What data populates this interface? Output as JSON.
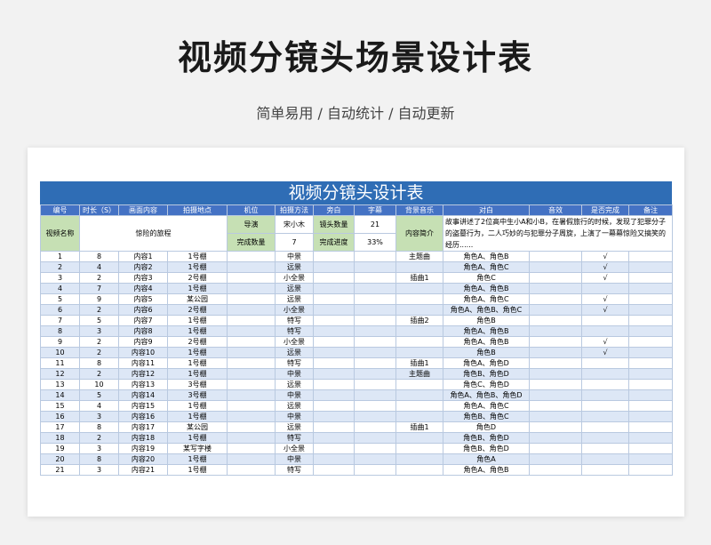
{
  "header": {
    "title": "视频分镜头场景设计表",
    "subtitle": "简单易用 / 自动统计 / 自动更新"
  },
  "sheet": {
    "banner_title": "视频分镜头设计表",
    "info": {
      "video_name_label": "视频名称",
      "video_name_value": "惊险的旅程",
      "director_label": "导演",
      "director_value": "宋小木",
      "shot_count_label": "镜头数量",
      "shot_count_value": "21",
      "completed_count_label": "完成数量",
      "completed_count_value": "7",
      "progress_label": "完成进度",
      "progress_value": "33%",
      "intro_label": "内容简介",
      "intro_text": "故事讲述了2位高中生小A和小B，在暑假旅行的时候，发现了犯罪分子的盗墓行为，二人巧妙的与犯罪分子周旋，上演了一幕幕惊险又搞笑的经历......"
    },
    "columns": [
      "编号",
      "时长（S）",
      "画面内容",
      "拍摄地点",
      "机位",
      "拍摄方法",
      "旁白",
      "字幕",
      "背景音乐",
      "对白",
      "音效",
      "是否完成",
      "备注"
    ],
    "rows": [
      [
        "1",
        "8",
        "内容1",
        "1号棚",
        "",
        "中景",
        "",
        "",
        "主题曲",
        "角色A、角色B",
        "",
        "√",
        ""
      ],
      [
        "2",
        "4",
        "内容2",
        "1号棚",
        "",
        "远景",
        "",
        "",
        "",
        "角色A、角色C",
        "",
        "√",
        ""
      ],
      [
        "3",
        "2",
        "内容3",
        "2号棚",
        "",
        "小全景",
        "",
        "",
        "插曲1",
        "角色C",
        "",
        "√",
        ""
      ],
      [
        "4",
        "7",
        "内容4",
        "1号棚",
        "",
        "远景",
        "",
        "",
        "",
        "角色A、角色B",
        "",
        "",
        ""
      ],
      [
        "5",
        "9",
        "内容5",
        "某公园",
        "",
        "远景",
        "",
        "",
        "",
        "角色A、角色C",
        "",
        "√",
        ""
      ],
      [
        "6",
        "2",
        "内容6",
        "2号棚",
        "",
        "小全景",
        "",
        "",
        "",
        "角色A、角色B、角色C",
        "",
        "√",
        ""
      ],
      [
        "7",
        "5",
        "内容7",
        "1号棚",
        "",
        "特写",
        "",
        "",
        "插曲2",
        "角色B",
        "",
        "",
        ""
      ],
      [
        "8",
        "3",
        "内容8",
        "1号棚",
        "",
        "特写",
        "",
        "",
        "",
        "角色A、角色B",
        "",
        "",
        ""
      ],
      [
        "9",
        "2",
        "内容9",
        "2号棚",
        "",
        "小全景",
        "",
        "",
        "",
        "角色A、角色B",
        "",
        "√",
        ""
      ],
      [
        "10",
        "2",
        "内容10",
        "1号棚",
        "",
        "远景",
        "",
        "",
        "",
        "角色B",
        "",
        "√",
        ""
      ],
      [
        "11",
        "8",
        "内容11",
        "1号棚",
        "",
        "特写",
        "",
        "",
        "插曲1",
        "角色A、角色D",
        "",
        "",
        ""
      ],
      [
        "12",
        "2",
        "内容12",
        "1号棚",
        "",
        "中景",
        "",
        "",
        "主题曲",
        "角色B、角色D",
        "",
        "",
        ""
      ],
      [
        "13",
        "10",
        "内容13",
        "3号棚",
        "",
        "远景",
        "",
        "",
        "",
        "角色C、角色D",
        "",
        "",
        ""
      ],
      [
        "14",
        "5",
        "内容14",
        "3号棚",
        "",
        "中景",
        "",
        "",
        "",
        "角色A、角色B、角色D",
        "",
        "",
        ""
      ],
      [
        "15",
        "4",
        "内容15",
        "1号棚",
        "",
        "远景",
        "",
        "",
        "",
        "角色A、角色C",
        "",
        "",
        ""
      ],
      [
        "16",
        "3",
        "内容16",
        "1号棚",
        "",
        "中景",
        "",
        "",
        "",
        "角色B、角色C",
        "",
        "",
        ""
      ],
      [
        "17",
        "8",
        "内容17",
        "某公园",
        "",
        "远景",
        "",
        "",
        "插曲1",
        "角色D",
        "",
        "",
        ""
      ],
      [
        "18",
        "2",
        "内容18",
        "1号棚",
        "",
        "特写",
        "",
        "",
        "",
        "角色B、角色D",
        "",
        "",
        ""
      ],
      [
        "19",
        "3",
        "内容19",
        "某写字楼",
        "",
        "小全景",
        "",
        "",
        "",
        "角色B、角色D",
        "",
        "",
        ""
      ],
      [
        "20",
        "8",
        "内容20",
        "1号棚",
        "",
        "中景",
        "",
        "",
        "",
        "角色A",
        "",
        "",
        ""
      ],
      [
        "21",
        "3",
        "内容21",
        "1号棚",
        "",
        "特写",
        "",
        "",
        "",
        "角色A、角色B",
        "",
        "",
        ""
      ]
    ]
  }
}
